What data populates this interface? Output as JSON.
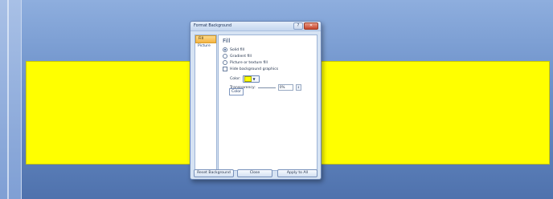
{
  "dialog": {
    "title": "Format Background",
    "window_buttons": {
      "minimize": "?",
      "close": "✕"
    },
    "nav": [
      {
        "label": "Fill",
        "active": true
      },
      {
        "label": "Picture",
        "active": false
      }
    ],
    "fill": {
      "heading": "Fill",
      "options": [
        {
          "label": "Solid fill",
          "type": "radio",
          "selected": true
        },
        {
          "label": "Gradient fill",
          "type": "radio",
          "selected": false
        },
        {
          "label": "Picture or texture fill",
          "type": "radio",
          "selected": false
        },
        {
          "label": "Hide background graphics",
          "type": "checkbox",
          "checked": false
        }
      ],
      "color_label": "Color:",
      "color_value": "#ffff00",
      "tooltip": "Color",
      "transparency_label": "Transparency:",
      "transparency_value": "0%"
    },
    "buttons": {
      "reset": "Reset Background",
      "close": "Close",
      "apply_all": "Apply to All"
    }
  },
  "slide": {
    "background_color": "#ffff00"
  }
}
